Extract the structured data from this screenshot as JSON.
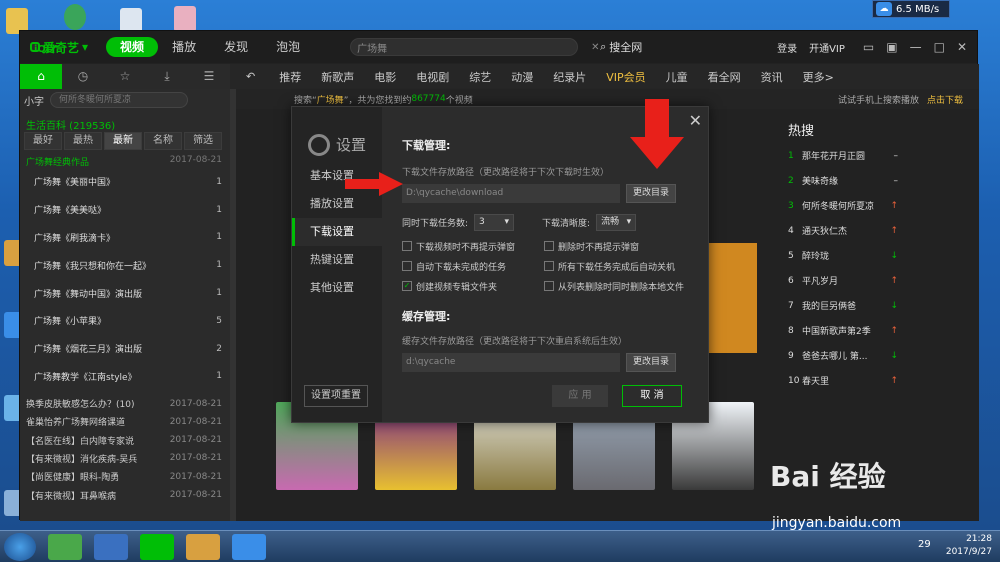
{
  "desktop": {
    "netspeed": "6.5 MB/s"
  },
  "app": {
    "logo": "爱奇艺",
    "logo_box": "iQIY",
    "topnav": [
      "视频",
      "播放",
      "发现",
      "泡泡"
    ],
    "search_placeholder": "广场舞",
    "search_button": "搜全网",
    "login": "登录",
    "vip": "开通VIP",
    "channels": [
      "推荐",
      "新歌声",
      "电影",
      "电视剧",
      "综艺",
      "动漫",
      "纪录片",
      "VIP会员",
      "儿童",
      "看全网",
      "资讯",
      "更多>"
    ]
  },
  "sidebar": {
    "select": "小字",
    "search_placeholder": "何所冬暖何所夏凉",
    "category": "生活百科 (219536)",
    "tabs": [
      "最好",
      "最热",
      "最新",
      "名称",
      "筛选"
    ],
    "group": {
      "label": "广场舞经典作品",
      "date": "2017-08-21"
    },
    "items": [
      {
        "label": "广场舞《美丽中国》",
        "n": "1"
      },
      {
        "label": "广场舞《美美哒》",
        "n": "1"
      },
      {
        "label": "广场舞《刷我滴卡》",
        "n": "1"
      },
      {
        "label": "广场舞《我只想和你在一起》",
        "n": "1"
      },
      {
        "label": "广场舞《舞动中国》演出版",
        "n": "1"
      },
      {
        "label": "广场舞《小苹果》",
        "n": "5"
      },
      {
        "label": "广场舞《烟花三月》演出版",
        "n": "2"
      },
      {
        "label": "广场舞教学《江南style》",
        "n": "1"
      }
    ],
    "episodes": [
      {
        "label": "换季皮肤敏感怎么办？(10)",
        "date": "2017-08-21"
      },
      {
        "label": "雀巢怡养广场舞网络课道",
        "date": "2017-08-21"
      },
      {
        "label": "【名医在线】白内障专家说",
        "date": "2017-08-21"
      },
      {
        "label": "【有来微视】消化疾病-吴兵",
        "date": "2017-08-21"
      },
      {
        "label": "【尚医健康】眼科-陶勇",
        "date": "2017-08-21"
      },
      {
        "label": "【有来微视】耳鼻喉病",
        "date": "2017-08-21"
      }
    ]
  },
  "results": {
    "prefix": "搜索“",
    "keyword": "广场舞",
    "mid": "”，共为您找到约",
    "count": "867774",
    "suffix": "个视频",
    "try_phone": "试试手机上搜索播放",
    "download": "点击下载"
  },
  "hot": {
    "title": "热搜",
    "items": [
      {
        "i": "1",
        "t": "那年花开月正圆",
        "trend": "same"
      },
      {
        "i": "2",
        "t": "美味奇缘",
        "trend": "same"
      },
      {
        "i": "3",
        "t": "何所冬暖何所夏凉",
        "trend": "up"
      },
      {
        "i": "4",
        "t": "通天狄仁杰",
        "trend": "up"
      },
      {
        "i": "5",
        "t": "醉玲珑",
        "trend": "down"
      },
      {
        "i": "6",
        "t": "平凡岁月",
        "trend": "up"
      },
      {
        "i": "7",
        "t": "我的巨另俩爸",
        "trend": "down"
      },
      {
        "i": "8",
        "t": "中国新歌声第2季",
        "trend": "up"
      },
      {
        "i": "9",
        "t": "爸爸去哪儿 第...",
        "trend": "down"
      },
      {
        "i": "10",
        "t": "春天里",
        "trend": "up"
      }
    ]
  },
  "dialog": {
    "title": "设置",
    "nav": [
      "基本设置",
      "播放设置",
      "下载设置",
      "热键设置",
      "其他设置"
    ],
    "reset": "设置项重置",
    "download_title": "下载管理:",
    "download_desc": "下载文件存放路径（更改路径将于下次下载时生效）",
    "download_path": "D:\\qycache\\download",
    "change_dir": "更改目录",
    "tasks_label": "同时下载任务数:",
    "tasks_value": "3",
    "quality_label": "下载清晰度:",
    "quality_value": "流畅",
    "checks": [
      {
        "label": "下载视频时不再提示弹窗",
        "checked": false
      },
      {
        "label": "删除时不再提示弹窗",
        "checked": false
      },
      {
        "label": "自动下载未完成的任务",
        "checked": false
      },
      {
        "label": "所有下载任务完成后自动关机",
        "checked": false
      },
      {
        "label": "创建视频专辑文件夹",
        "checked": true
      },
      {
        "label": "从列表删除时同时删除本地文件",
        "checked": false
      }
    ],
    "cache_title": "缓存管理:",
    "cache_desc": "缓存文件存放路径（更改路径将于下次重启系统后生效）",
    "cache_path": "d:\\qycache",
    "change_dir2": "更改目录",
    "apply": "应 用",
    "cancel": "取 消"
  },
  "taskbar": {
    "time": "21:28",
    "date": "2017/9/27",
    "badge": "29"
  },
  "watermark": "Bai 经验",
  "watermark_url": "jingyan.baidu.com"
}
